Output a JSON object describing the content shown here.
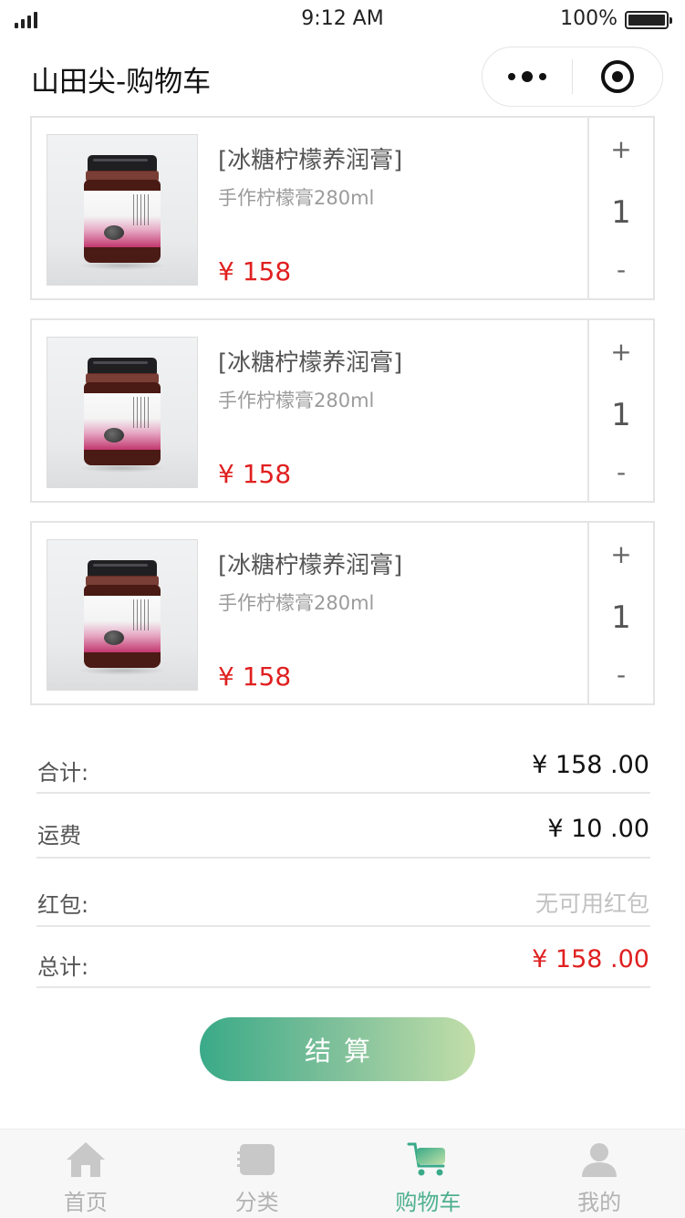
{
  "status_bar": {
    "time": "9:12 AM",
    "battery": "100%"
  },
  "nav": {
    "title": "山田尖-购物车"
  },
  "cart": {
    "items": [
      {
        "name": "[冰糖柠檬养润膏]",
        "spec": "手作柠檬膏280ml",
        "price": "¥ 158",
        "qty_plus": "+",
        "quantity": "1",
        "qty_minus": "-"
      },
      {
        "name": "[冰糖柠檬养润膏]",
        "spec": "手作柠檬膏280ml",
        "price": "¥ 158",
        "qty_plus": "+",
        "quantity": "1",
        "qty_minus": "-"
      },
      {
        "name": "[冰糖柠檬养润膏]",
        "spec": "手作柠檬膏280ml",
        "price": "¥ 158",
        "qty_plus": "+",
        "quantity": "1",
        "qty_minus": "-"
      }
    ]
  },
  "summary": {
    "subtotal_label": "合计:",
    "subtotal_value": "¥ 158 .00",
    "shipping_label": "运费",
    "shipping_value": "¥ 10 .00",
    "coupon_label": "红包:",
    "coupon_value": "无可用红包",
    "total_label": "总计:",
    "total_value": "¥ 158 .00"
  },
  "checkout_label": "结算",
  "tabs": [
    {
      "label": "首页",
      "icon": "home-icon"
    },
    {
      "label": "分类",
      "icon": "category-icon"
    },
    {
      "label": "购物车",
      "icon": "cart-icon"
    },
    {
      "label": "我的",
      "icon": "user-icon"
    }
  ],
  "colors": {
    "accent": "#4fb08f",
    "price": "#e02020",
    "muted": "#b2b2b2"
  }
}
